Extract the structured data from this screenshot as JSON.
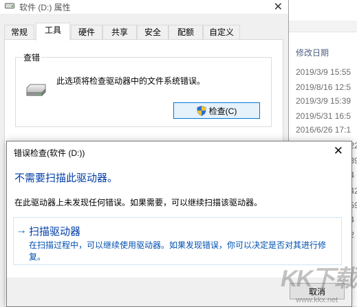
{
  "explorer": {
    "column_header": "修改日期",
    "dates": [
      "2019/3/9 15:55",
      "2019/8/16 12:5",
      "2019/3/9 15:39",
      "2019/5/31 16:5",
      "2016/6/26 17:1"
    ],
    "stubs": [
      ":22",
      ":39",
      ":4",
      ":42",
      ":59",
      ":4",
      ":2"
    ]
  },
  "props": {
    "title": "软件 (D:) 属性",
    "tabs": [
      "常规",
      "工具",
      "硬件",
      "共享",
      "安全",
      "配额",
      "自定义"
    ],
    "group_title": "查错",
    "group_desc": "此选项将检查驱动器中的文件系统错误。",
    "check_button": "检查(C)"
  },
  "dialog": {
    "title": "错误检查(软件 (D:))",
    "heading": "不需要扫描此驱动器。",
    "message": "在此驱动器上未发现任何错误。如果需要，可以继续扫描该驱动器。",
    "scan_title": "扫描驱动器",
    "scan_desc": "在扫描过程中，可以继续使用驱动器。如果发现错误，你可以决定是否对其进行修复。",
    "cancel": "取消"
  },
  "watermark": {
    "logo": "KK下载",
    "url": "www.kkx.net"
  },
  "colors": {
    "accent": "#0078d7",
    "link": "#003ea8"
  }
}
